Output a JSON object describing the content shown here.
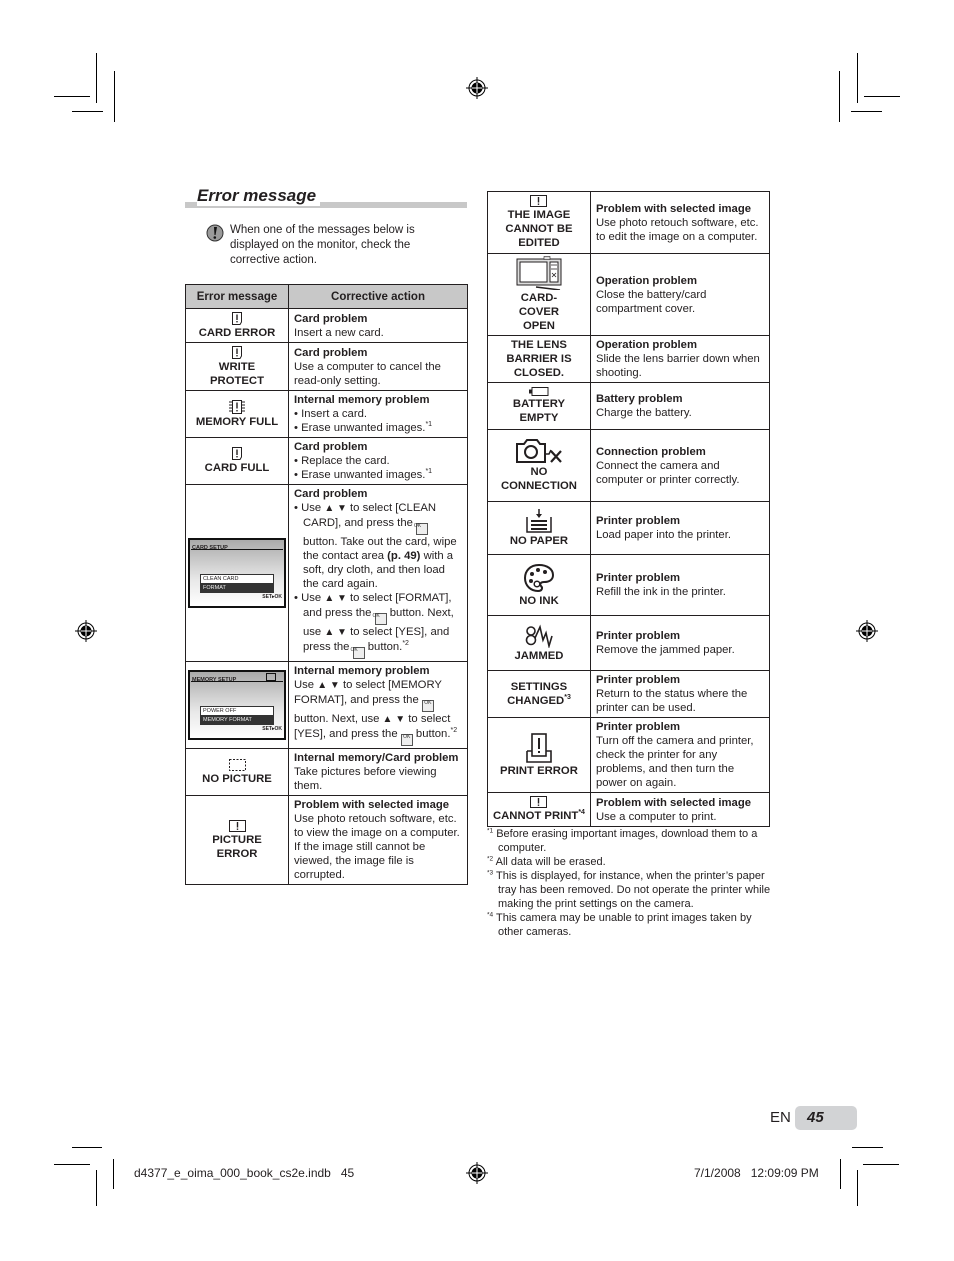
{
  "section": {
    "title": "Error message",
    "note": "When one of the messages below is displayed on the monitor, check the corrective action."
  },
  "table_headers": {
    "message": "Error message",
    "action": "Corrective action"
  },
  "left_rows": [
    {
      "icon": "card-alert-icon",
      "message": "CARD ERROR",
      "heading": "Card problem",
      "lines": [
        "Insert a new card."
      ]
    },
    {
      "icon": "card-alert-icon",
      "message": "WRITE PROTECT",
      "heading": "Card problem",
      "lines": [
        "Use a computer to cancel the read-only setting."
      ]
    },
    {
      "icon": "memory-alert-icon",
      "message": "MEMORY FULL",
      "heading": "Internal memory problem",
      "bullets": [
        "Insert a card.",
        "Erase unwanted images."
      ],
      "bullet_note": "*1"
    },
    {
      "icon": "card-alert-icon",
      "message": "CARD FULL",
      "heading": "Card problem",
      "bullets": [
        "Replace the card.",
        "Erase unwanted images."
      ],
      "bullet_note": "*1"
    },
    {
      "screen": {
        "title": "CARD SETUP",
        "options": [
          "CLEAN CARD",
          "FORMAT"
        ],
        "footer": "SET▸OK"
      },
      "heading": "Card problem",
      "b1": {
        "a": "Use",
        "b": "to select [CLEAN CARD], and press the",
        "c": "button. Take out the card, wipe the contact area",
        "ref": "(p. 49)",
        "d": "with a soft, dry cloth, and then load the card again."
      },
      "b2": {
        "a": "Use",
        "b": "to select [FORMAT], and press the",
        "c": "button. Next, use",
        "d": "to select [YES], and press the",
        "e": "button.",
        "note": "*2"
      }
    },
    {
      "screen": {
        "title": "MEMORY SETUP",
        "options": [
          "POWER OFF",
          "MEMORY FORMAT"
        ],
        "footer": "SET▸OK"
      },
      "heading": "Internal memory problem",
      "t": {
        "a": "Use",
        "b": "to select [MEMORY FORMAT], and press the",
        "c": "button. Next, use",
        "d": "to select [YES], and press the",
        "e": "button.",
        "note": "*2"
      }
    },
    {
      "icon": "empty-frame-icon",
      "message": "NO PICTURE",
      "heading": "Internal memory/Card problem",
      "lines": [
        "Take pictures before viewing them."
      ]
    },
    {
      "icon": "picture-alert-icon",
      "message": "PICTURE ERROR",
      "heading": "Problem with selected image",
      "lines": [
        "Use photo retouch software, etc. to view the image on a computer. If the image still cannot be viewed, the image file is corrupted."
      ]
    }
  ],
  "right_rows": [
    {
      "icon": "picture-alert-icon",
      "message": "THE IMAGE CANNOT BE EDITED",
      "heading": "Problem with selected image",
      "lines": [
        "Use photo retouch software, etc. to edit the image on a computer."
      ]
    },
    {
      "icon": "card-cover-open-icon",
      "message": "CARD-COVER OPEN",
      "heading": "Operation problem",
      "lines": [
        "Close the battery/card compartment cover."
      ]
    },
    {
      "icon": "",
      "message": "THE LENS BARRIER IS CLOSED.",
      "heading": "Operation problem",
      "lines": [
        "Slide the lens barrier down when shooting."
      ]
    },
    {
      "icon": "battery-empty-icon",
      "message": "BATTERY EMPTY",
      "heading": "Battery problem",
      "lines": [
        "Charge the battery."
      ]
    },
    {
      "icon": "no-connection-icon",
      "message": "NO CONNECTION",
      "heading": "Connection problem",
      "lines": [
        "Connect the camera and computer or printer correctly."
      ]
    },
    {
      "icon": "no-paper-icon",
      "message": "NO PAPER",
      "heading": "Printer problem",
      "lines": [
        "Load paper into the printer."
      ]
    },
    {
      "icon": "no-ink-icon",
      "message": "NO INK",
      "heading": "Printer problem",
      "lines": [
        "Refill the ink in the printer."
      ]
    },
    {
      "icon": "jammed-icon",
      "message": "JAMMED",
      "heading": "Printer problem",
      "lines": [
        "Remove the jammed paper."
      ]
    },
    {
      "icon": "",
      "message": "SETTINGS CHANGED",
      "message_note": "*3",
      "heading": "Printer problem",
      "lines": [
        "Return to the status where the printer can be used."
      ]
    },
    {
      "icon": "print-error-icon",
      "message": "PRINT ERROR",
      "heading": "Printer problem",
      "lines": [
        "Turn off the camera and printer, check the printer for any problems, and then turn the power on again."
      ]
    },
    {
      "icon": "picture-alert-icon",
      "message": "CANNOT PRINT",
      "message_note": "*4",
      "heading": "Problem with selected image",
      "lines": [
        "Use a computer to print."
      ]
    }
  ],
  "footnotes": [
    {
      "mark": "*1",
      "text": "Before erasing important images, download them to a computer."
    },
    {
      "mark": "*2",
      "text": "All data will be erased."
    },
    {
      "mark": "*3",
      "text": "This is displayed, for instance, when the printer’s paper tray has been removed. Do not operate the printer while making the print settings on the camera."
    },
    {
      "mark": "*4",
      "text": "This camera may be unable to print images taken by other cameras."
    }
  ],
  "page": {
    "lang": "EN",
    "number": "45"
  },
  "slug": {
    "file": "d4377_e_oima_000_book_cs2e.indb   45",
    "date": "7/1/2008   12:09:09 PM"
  },
  "glyphs": {
    "updown": "▲ ▼",
    "ok": "OK"
  }
}
